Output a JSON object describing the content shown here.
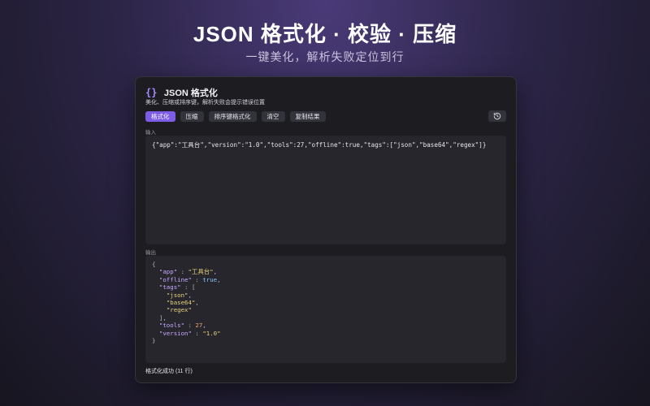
{
  "hero": {
    "title": "JSON 格式化 · 校验 · 压缩",
    "subtitle": "一键美化，解析失败定位到行"
  },
  "window": {
    "icon": "curly-braces-icon",
    "icon_glyph": "{}",
    "title": "JSON 格式化",
    "description": "美化、压缩或排序键，解析失败会提示错误位置"
  },
  "toolbar": {
    "format_label": "格式化",
    "minify_label": "压缩",
    "sort_format_label": "排序键格式化",
    "clear_label": "清空",
    "copy_label": "复制结果",
    "history_icon": "history-icon"
  },
  "input": {
    "label": "输入",
    "value": "{\"app\":\"工具台\",\"version\":\"1.0\",\"tools\":27,\"offline\":true,\"tags\":[\"json\",\"base64\",\"regex\"]}"
  },
  "output": {
    "label": "输出",
    "lines": [
      {
        "indent": "",
        "tokens": [
          {
            "t": "p",
            "v": "{"
          }
        ]
      },
      {
        "indent": "  ",
        "tokens": [
          {
            "t": "k",
            "v": "\"app\""
          },
          {
            "t": "p",
            "v": " : "
          },
          {
            "t": "s",
            "v": "\"工具台\""
          },
          {
            "t": "p",
            "v": ","
          }
        ]
      },
      {
        "indent": "  ",
        "tokens": [
          {
            "t": "k",
            "v": "\"offline\""
          },
          {
            "t": "p",
            "v": " : "
          },
          {
            "t": "b",
            "v": "true"
          },
          {
            "t": "p",
            "v": ","
          }
        ]
      },
      {
        "indent": "  ",
        "tokens": [
          {
            "t": "k",
            "v": "\"tags\""
          },
          {
            "t": "p",
            "v": " : ["
          }
        ]
      },
      {
        "indent": "    ",
        "tokens": [
          {
            "t": "s",
            "v": "\"json\""
          },
          {
            "t": "p",
            "v": ","
          }
        ]
      },
      {
        "indent": "    ",
        "tokens": [
          {
            "t": "s",
            "v": "\"base64\""
          },
          {
            "t": "p",
            "v": ","
          }
        ]
      },
      {
        "indent": "    ",
        "tokens": [
          {
            "t": "s",
            "v": "\"regex\""
          }
        ]
      },
      {
        "indent": "  ",
        "tokens": [
          {
            "t": "p",
            "v": "],"
          }
        ]
      },
      {
        "indent": "  ",
        "tokens": [
          {
            "t": "k",
            "v": "\"tools\""
          },
          {
            "t": "p",
            "v": " : "
          },
          {
            "t": "n",
            "v": "27"
          },
          {
            "t": "p",
            "v": ","
          }
        ]
      },
      {
        "indent": "  ",
        "tokens": [
          {
            "t": "k",
            "v": "\"version\""
          },
          {
            "t": "p",
            "v": " : "
          },
          {
            "t": "s",
            "v": "\"1.0\""
          }
        ]
      },
      {
        "indent": "",
        "tokens": [
          {
            "t": "p",
            "v": "}"
          }
        ]
      }
    ]
  },
  "status": "格式化成功 (11 行)",
  "colors": {
    "accent": "#7c5ce4",
    "key": "#c8a8ff",
    "string": "#e8d27a",
    "boolean": "#7fc6ff",
    "number": "#f0a46a"
  }
}
